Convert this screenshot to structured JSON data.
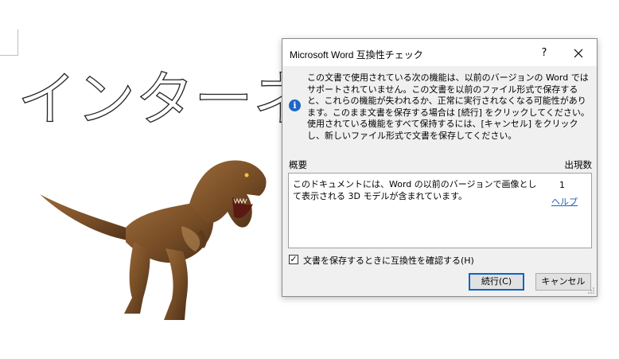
{
  "document": {
    "outline_heading": "インターネット"
  },
  "dialog": {
    "title": "Microsoft Word 互換性チェック",
    "help_glyph": "?",
    "message": "この文書で使用されている次の機能は、以前のバージョンの Word ではサポートされていません。この文書を以前のファイル形式で保存すると、これらの機能が失われるか、正常に実行されなくなる可能性があります。このまま文書を保存する場合は [続行] をクリックしてください。使用されている機能をすべて保持するには、[キャンセル] をクリックし、新しいファイル形式で文書を保存してください。",
    "summary_header": "概要",
    "count_header": "出現数",
    "issues": [
      {
        "text": "このドキュメントには、Word の以前のバージョンで画像として表示される 3D モデルが含まれています。",
        "count": "1",
        "help_link": "ヘルプ"
      }
    ],
    "checkbox": {
      "label": "文書を保存するときに互換性を確認する(H)",
      "checked": true
    },
    "buttons": {
      "continue": "続行(C)",
      "cancel": "キャンセル"
    },
    "accent_color": "#0a64c8",
    "info_icon_color": "#1e66c8",
    "link_color": "#1a5fbf"
  }
}
